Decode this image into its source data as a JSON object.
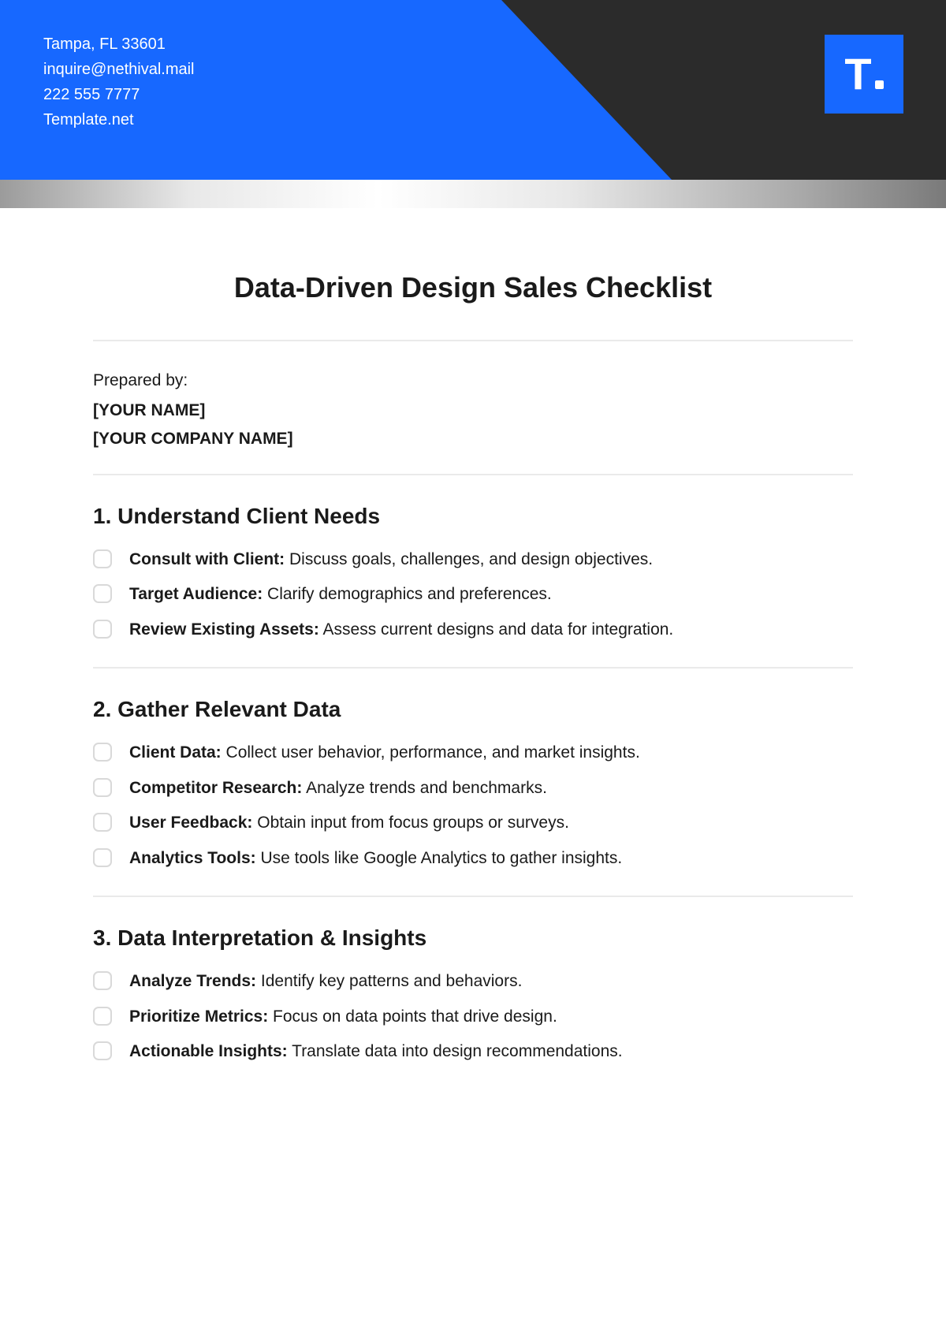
{
  "header": {
    "address": "Tampa, FL 33601",
    "email": "inquire@nethival.mail",
    "phone": "222 555 7777",
    "site": "Template.net",
    "logo_letter": "T"
  },
  "title": "Data-Driven Design Sales Checklist",
  "prepared_by_label": "Prepared by:",
  "name_placeholder": "[YOUR NAME]",
  "company_placeholder": "[YOUR COMPANY NAME]",
  "sections": [
    {
      "title": "1. Understand Client Needs",
      "items": [
        {
          "bold": "Consult with Client:",
          "text": " Discuss goals, challenges, and design objectives."
        },
        {
          "bold": "Target Audience:",
          "text": " Clarify demographics and preferences."
        },
        {
          "bold": "Review Existing Assets:",
          "text": " Assess current designs and data for integration."
        }
      ]
    },
    {
      "title": "2. Gather Relevant Data",
      "items": [
        {
          "bold": "Client Data:",
          "text": " Collect user behavior, performance, and market insights."
        },
        {
          "bold": "Competitor Research:",
          "text": " Analyze trends and benchmarks."
        },
        {
          "bold": "User Feedback:",
          "text": " Obtain input from focus groups or surveys."
        },
        {
          "bold": "Analytics Tools:",
          "text": " Use tools like Google Analytics to gather insights."
        }
      ]
    },
    {
      "title": "3. Data Interpretation & Insights",
      "items": [
        {
          "bold": "Analyze Trends:",
          "text": " Identify key patterns and behaviors."
        },
        {
          "bold": "Prioritize Metrics:",
          "text": " Focus on data points that drive design."
        },
        {
          "bold": "Actionable Insights:",
          "text": " Translate data into design recommendations."
        }
      ]
    }
  ]
}
